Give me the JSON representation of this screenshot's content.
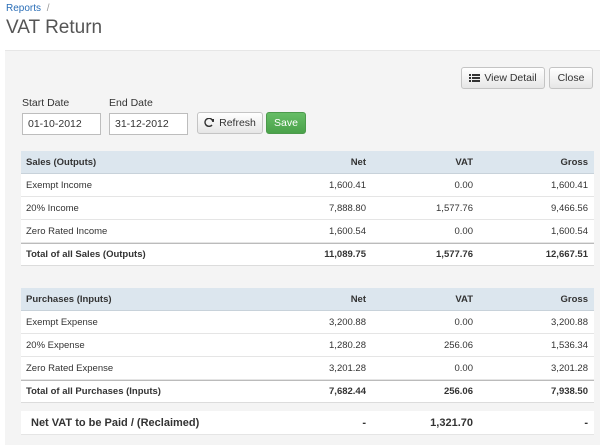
{
  "breadcrumb": {
    "link": "Reports",
    "sep": "/"
  },
  "page": {
    "title": "VAT Return"
  },
  "toolbar": {
    "view_detail": "View Detail",
    "close": "Close"
  },
  "filters": {
    "start_label": "Start Date",
    "start_value": "01-10-2012",
    "end_label": "End Date",
    "end_value": "31-12-2012",
    "refresh": "Refresh",
    "save": "Save"
  },
  "sales": {
    "headers": [
      "Sales (Outputs)",
      "Net",
      "VAT",
      "Gross"
    ],
    "rows": [
      [
        "Exempt Income",
        "1,600.41",
        "0.00",
        "1,600.41"
      ],
      [
        "20% Income",
        "7,888.80",
        "1,577.76",
        "9,466.56"
      ],
      [
        "Zero Rated Income",
        "1,600.54",
        "0.00",
        "1,600.54"
      ]
    ],
    "total": [
      "Total of all Sales (Outputs)",
      "11,089.75",
      "1,577.76",
      "12,667.51"
    ]
  },
  "purchases": {
    "headers": [
      "Purchases (Inputs)",
      "Net",
      "VAT",
      "Gross"
    ],
    "rows": [
      [
        "Exempt Expense",
        "3,200.88",
        "0.00",
        "3,200.88"
      ],
      [
        "20% Expense",
        "1,280.28",
        "256.06",
        "1,536.34"
      ],
      [
        "Zero Rated Expense",
        "3,201.28",
        "0.00",
        "3,201.28"
      ]
    ],
    "total": [
      "Total of all Purchases (Inputs)",
      "7,682.44",
      "256.06",
      "7,938.50"
    ]
  },
  "net_vat": [
    "Net VAT to be Paid / (Reclaimed)",
    "-",
    "1,321.70",
    "-"
  ],
  "colors": {
    "header_bg": "#dce6ee",
    "save_green": "#5cb85c",
    "link_blue": "#2a6eb7"
  }
}
